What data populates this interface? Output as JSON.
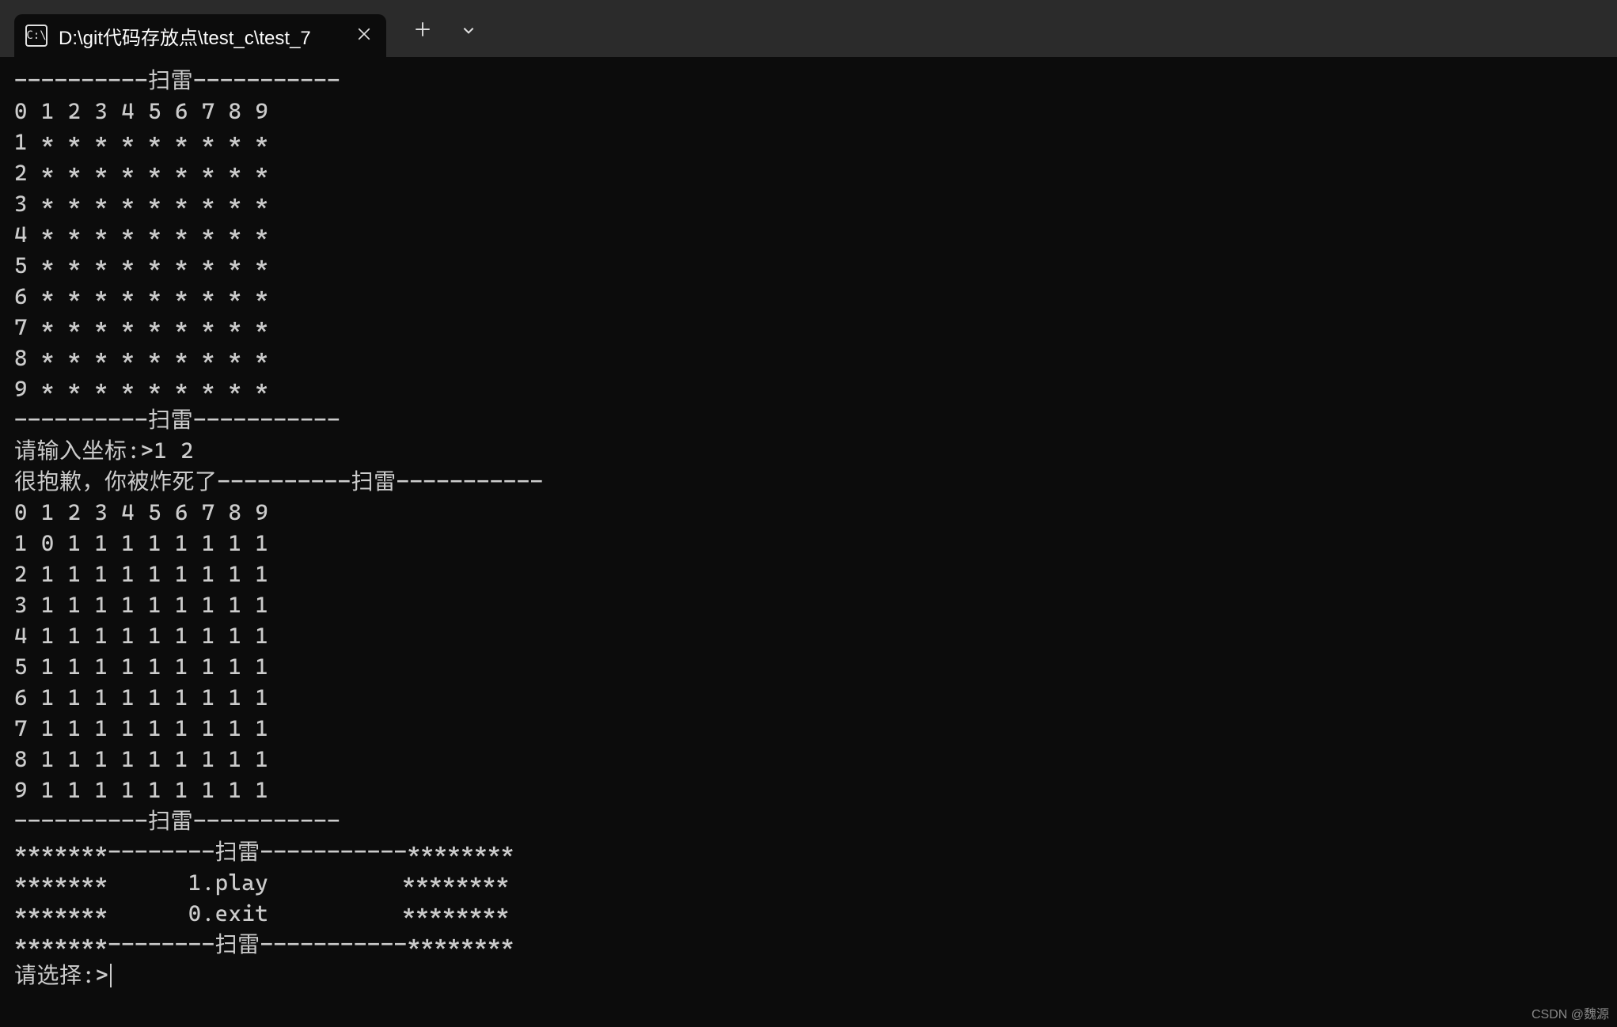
{
  "titlebar": {
    "tab_title": "D:\\git代码存放点\\test_c\\test_7",
    "tab_icon_label": "C:\\"
  },
  "terminal": {
    "lines": [
      "----------扫雷-----------",
      "0 1 2 3 4 5 6 7 8 9",
      "1 * * * * * * * * *",
      "2 * * * * * * * * *",
      "3 * * * * * * * * *",
      "4 * * * * * * * * *",
      "5 * * * * * * * * *",
      "6 * * * * * * * * *",
      "7 * * * * * * * * *",
      "8 * * * * * * * * *",
      "9 * * * * * * * * *",
      "----------扫雷-----------",
      "请输入坐标:>1 2",
      "很抱歉，你被炸死了----------扫雷-----------",
      "0 1 2 3 4 5 6 7 8 9",
      "1 0 1 1 1 1 1 1 1 1",
      "2 1 1 1 1 1 1 1 1 1",
      "3 1 1 1 1 1 1 1 1 1",
      "4 1 1 1 1 1 1 1 1 1",
      "5 1 1 1 1 1 1 1 1 1",
      "6 1 1 1 1 1 1 1 1 1",
      "7 1 1 1 1 1 1 1 1 1",
      "8 1 1 1 1 1 1 1 1 1",
      "9 1 1 1 1 1 1 1 1 1",
      "----------扫雷-----------",
      "*******--------扫雷-----------********",
      "*******      1.play          ********",
      "*******      0.exit          ********",
      "*******--------扫雷-----------********"
    ],
    "prompt": "请选择:>"
  },
  "watermark": "CSDN @魏源"
}
